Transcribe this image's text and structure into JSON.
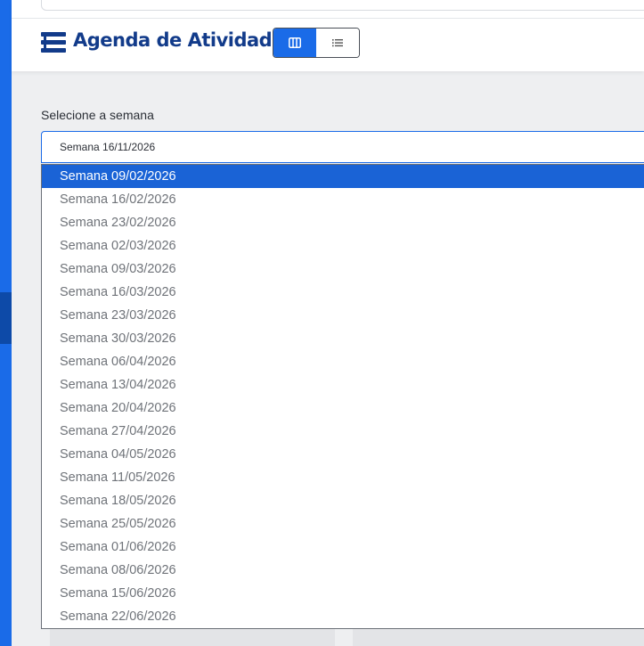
{
  "header": {
    "title": "Agenda de Atividades",
    "view_toggle": [
      {
        "name": "columns-view",
        "icon": "columns-icon",
        "active": true
      },
      {
        "name": "list-view",
        "icon": "list-icon",
        "active": false
      }
    ]
  },
  "week_selector": {
    "label": "Selecione a semana",
    "selected_value": "Semana 16/11/2026",
    "options": [
      "Semana 09/02/2026",
      "Semana 16/02/2026",
      "Semana 23/02/2026",
      "Semana 02/03/2026",
      "Semana 09/03/2026",
      "Semana 16/03/2026",
      "Semana 23/03/2026",
      "Semana 30/03/2026",
      "Semana 06/04/2026",
      "Semana 13/04/2026",
      "Semana 20/04/2026",
      "Semana 27/04/2026",
      "Semana 04/05/2026",
      "Semana 11/05/2026",
      "Semana 18/05/2026",
      "Semana 25/05/2026",
      "Semana 01/06/2026",
      "Semana 08/06/2026",
      "Semana 15/06/2026",
      "Semana 22/06/2026"
    ],
    "highlighted_option": "Semana 09/02/2026"
  },
  "colors": {
    "accent": "#1a6be8",
    "title": "#123b8a",
    "highlight": "#1a63d6"
  }
}
